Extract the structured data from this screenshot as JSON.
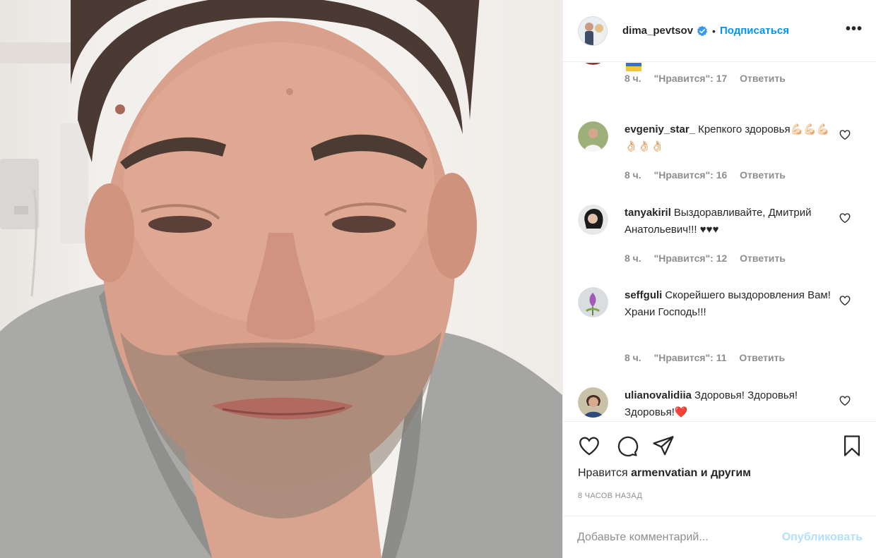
{
  "post": {
    "username": "dima_pevtsov",
    "follow_label": "Подписаться",
    "separator": "•",
    "more_label": "•••",
    "verified_icon": "verified-badge-icon",
    "colors": {
      "accent": "#0095f6",
      "text": "#262626",
      "muted": "#8e8e8e",
      "border": "#efefef",
      "verified": "#3897f0",
      "publish_disabled": "#b2dffc",
      "heart_red": "#ed4956"
    }
  },
  "comments": [
    {
      "user": "",
      "text": "",
      "time": "8 ч.",
      "likes": "\"Нравится\": 17",
      "reply": "Ответить"
    },
    {
      "user": "evgeniy_star_",
      "text": "Крепкого здоровья💪🏻💪🏻💪🏻👌🏻👌🏻👌🏻",
      "time": "8 ч.",
      "likes": "\"Нравится\": 16",
      "reply": "Ответить"
    },
    {
      "user": "tanyakiril",
      "text": "Выздоравливайте, Дмитрий Анатольевич!!! ♥♥♥",
      "time": "8 ч.",
      "likes": "\"Нравится\": 12",
      "reply": "Ответить"
    },
    {
      "user": "seffguli",
      "text": "Скорейшего выздоровления Вам! Храни Господь!!!",
      "time": "8 ч.",
      "likes": "\"Нравится\": 11",
      "reply": "Ответить"
    },
    {
      "user": "ulianovalidiia",
      "text": "Здоровья! Здоровья! Здоровья!❤️",
      "time": "",
      "likes": "",
      "reply": ""
    }
  ],
  "actions": {
    "icons": [
      "heart-outline-icon",
      "comment-bubble-icon",
      "share-plane-icon",
      "bookmark-icon"
    ]
  },
  "likes": {
    "prefix": "Нравится",
    "user": "armenvatian",
    "suffix": "и другим"
  },
  "time_ago": "8 ЧАСОВ НАЗАД",
  "comment_box": {
    "placeholder": "Добавьте комментарий...",
    "publish_label": "Опубликовать"
  }
}
